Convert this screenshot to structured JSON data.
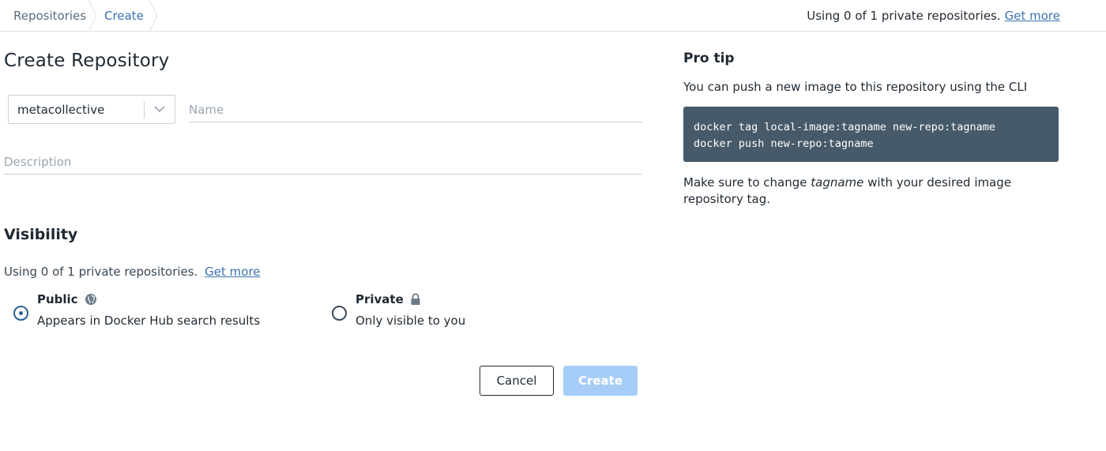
{
  "breadcrumb": {
    "items": [
      {
        "label": "Repositories"
      },
      {
        "label": "Create"
      }
    ]
  },
  "top_usage": {
    "text": "Using 0 of 1 private repositories.",
    "link": "Get more"
  },
  "form": {
    "title": "Create Repository",
    "namespace_value": "metacollective",
    "name_placeholder": "Name",
    "description_placeholder": "Description"
  },
  "visibility": {
    "title": "Visibility",
    "usage_text": "Using 0 of 1 private repositories.",
    "usage_link": "Get more",
    "options": [
      {
        "label": "Public",
        "description": "Appears in Docker Hub search results",
        "icon": "globe-icon",
        "selected": true
      },
      {
        "label": "Private",
        "description": "Only visible to you",
        "icon": "lock-icon",
        "selected": false
      }
    ]
  },
  "actions": {
    "cancel_label": "Cancel",
    "create_label": "Create"
  },
  "pro_tip": {
    "title": "Pro tip",
    "intro": "You can push a new image to this repository using the CLI",
    "code_lines": [
      "docker tag local-image:tagname new-repo:tagname",
      "docker push new-repo:tagname"
    ],
    "note_before": "Make sure to change ",
    "note_emphasis": "tagname",
    "note_after": " with your desired image repository tag."
  },
  "colors": {
    "link": "#3b73b0",
    "code_background": "#465a69",
    "create_button_disabled": "#a6cdf7",
    "radio_selected": "#2a5f95"
  }
}
